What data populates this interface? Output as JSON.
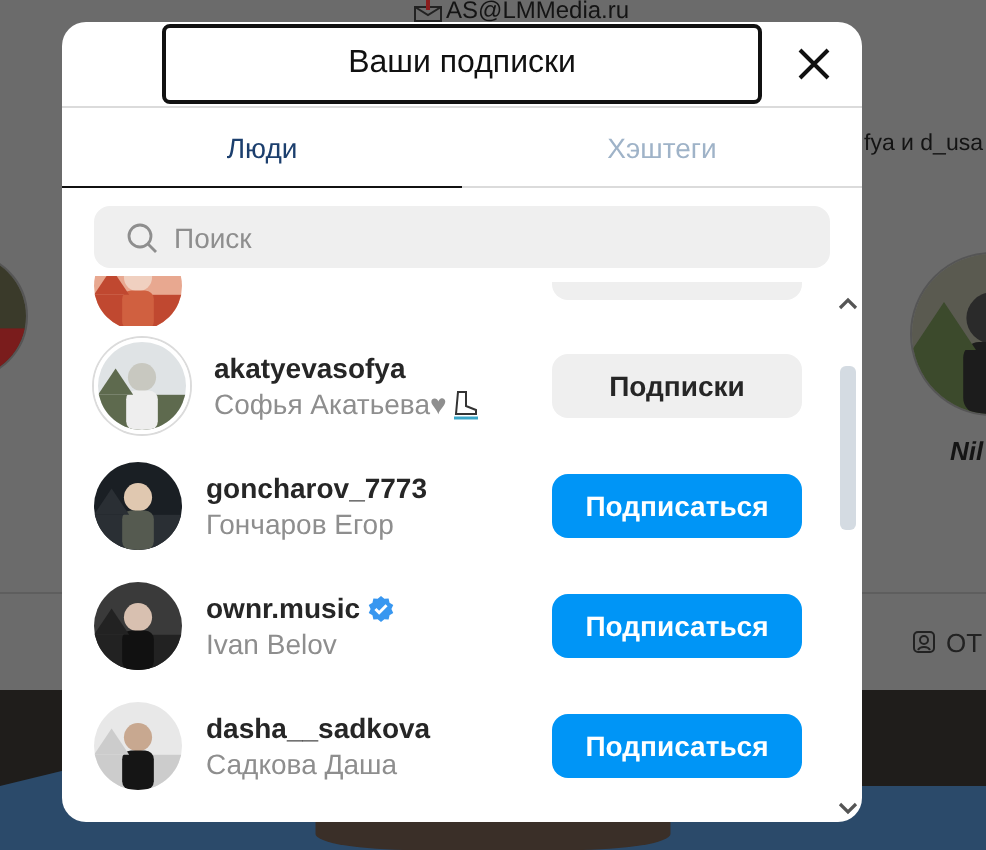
{
  "background": {
    "email": "AS@LMMedia.ru",
    "mutual_text": "fya и d_usa",
    "profile_name": "Nil",
    "tab_label": "ОТ"
  },
  "dialog": {
    "title": "Ваши подписки",
    "tabs": [
      {
        "label": "Люди",
        "selected": true
      },
      {
        "label": "Хэштеги",
        "selected": false
      }
    ],
    "search": {
      "placeholder": "Поиск"
    },
    "partial_row": {
      "following": true
    },
    "accounts": [
      {
        "username": "akatyevasofya",
        "full_name": "Софья Акатьева♥",
        "emoji": {
          "kind": "skate"
        },
        "verified": false,
        "following": true,
        "button": "Подписки"
      },
      {
        "username": "goncharov_7773",
        "full_name": "Гончаров Егор",
        "verified": false,
        "following": false,
        "button": "Подписаться"
      },
      {
        "username": "ownr.music",
        "full_name": "Ivan Belov",
        "verified": true,
        "following": false,
        "button": "Подписаться"
      },
      {
        "username": "dasha__sadkova",
        "full_name": "Садкова Даша",
        "verified": false,
        "following": false,
        "button": "Подписаться"
      }
    ]
  }
}
